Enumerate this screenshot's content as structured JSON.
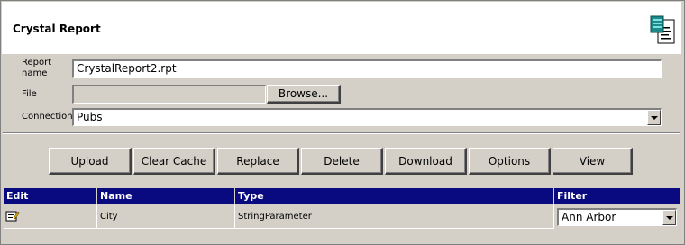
{
  "header": {
    "title": "Crystal Report",
    "icon": "report-document-icon"
  },
  "form": {
    "report_name_label": "Report name",
    "report_name_value": "CrystalReport2.rpt",
    "file_label": "File",
    "file_value": "",
    "browse_label": "Browse...",
    "connection_label": "Connection",
    "connection_value": "Pubs"
  },
  "toolbar": {
    "buttons": [
      "Upload",
      "Clear Cache",
      "Replace",
      "Delete",
      "Download",
      "Options",
      "View"
    ]
  },
  "grid": {
    "columns": [
      "Edit",
      "Name",
      "Type",
      "Filter"
    ],
    "rows": [
      {
        "edit_icon": "edit-icon",
        "name": "City",
        "type": "StringParameter",
        "filter": "Ann Arbor"
      }
    ]
  },
  "colors": {
    "grid_header_bg": "#0a0a80",
    "panel_bg": "#d4d0c8",
    "header_bg": "#ffffff"
  }
}
